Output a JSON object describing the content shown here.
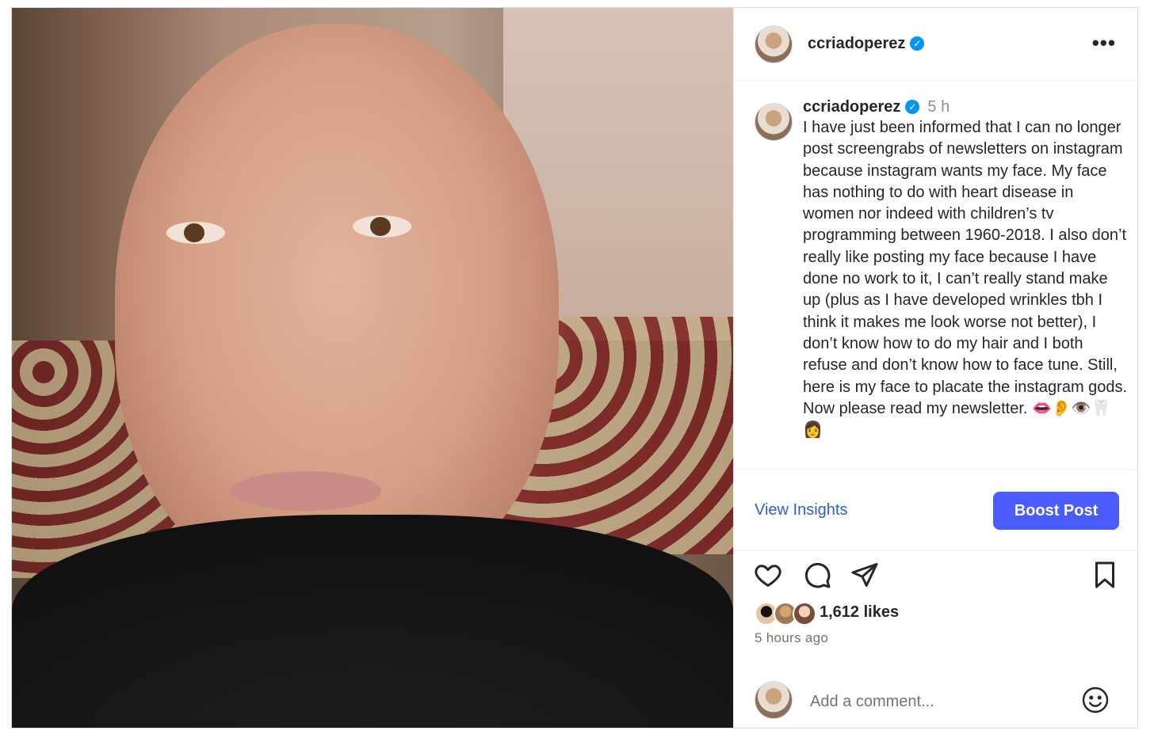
{
  "post": {
    "username": "ccriadoperez",
    "time": "5 h",
    "caption": "I have just been informed that I can no longer post screengrabs of newsletters on instagram because instagram wants my face. My face has nothing to do with heart disease in women nor indeed with children’s tv programming between 1960-2018. I also don’t really like posting my face because I have done no work to it, I can’t really stand make up (plus as I have developed wrinkles tbh I think it makes me look worse not better), I don’t know how to do my hair and I both refuse and don’t know how to face tune. Still, here is my face to placate the instagram gods. Now please read my newsletter. 👄👂👁️🦷👩",
    "likes": "1,612 likes",
    "time_ago": "5 hours ago"
  },
  "header": {
    "more_label": "•••",
    "verified_mark": "✓"
  },
  "actions": {
    "view_insights": "View Insights",
    "boost_post": "Boost Post"
  },
  "icons": [
    "heart-icon",
    "comment-icon",
    "share-icon",
    "bookmark-icon",
    "emoji-icon"
  ],
  "comment": {
    "placeholder": "Add a comment..."
  },
  "colors": {
    "boost": "#4a5cff",
    "link": "#2c5fc9",
    "verified": "#0095f6"
  }
}
